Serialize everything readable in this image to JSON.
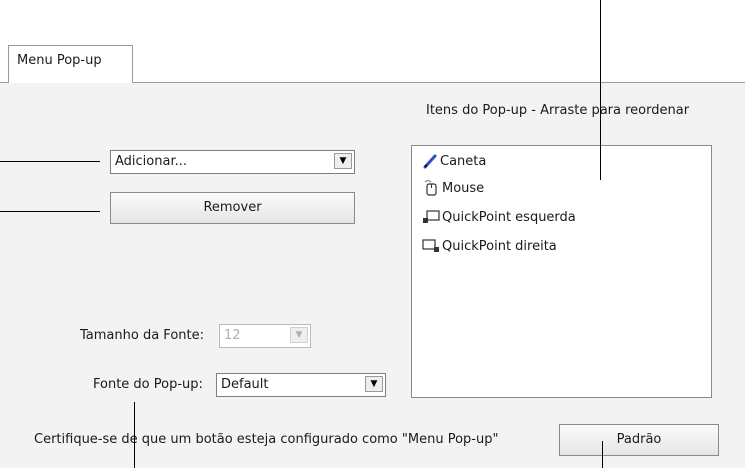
{
  "tab": {
    "label": "Menu Pop-up"
  },
  "list": {
    "caption": "Itens do Pop-up - Arraste para reordenar",
    "items": [
      {
        "label": "Caneta",
        "icon": "pen-icon"
      },
      {
        "label": "Mouse",
        "icon": "mouse-icon"
      },
      {
        "label": "QuickPoint esquerda",
        "icon": "quickpoint-left-icon"
      },
      {
        "label": "QuickPoint direita",
        "icon": "quickpoint-right-icon"
      }
    ]
  },
  "add_dropdown": {
    "value": "Adicionar..."
  },
  "remove_button": {
    "label": "Remover"
  },
  "font_size": {
    "label": "Tamanho da Fonte:",
    "value": "12"
  },
  "popup_font": {
    "label": "Fonte do Pop-up:",
    "value": "Default"
  },
  "footer": {
    "note": "Certifique-se de que um botão esteja configurado como \"Menu Pop-up\"",
    "default_button": "Padrão"
  },
  "colors": {
    "pen_blue": "#2b4fc7",
    "panel_bg": "#f3f3f3"
  }
}
